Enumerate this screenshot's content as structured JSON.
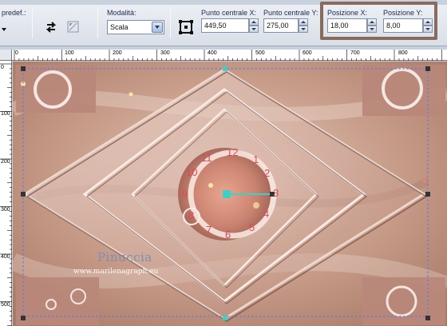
{
  "toolbar": {
    "preset_label": "predef.:",
    "mode_label": "Modalità:",
    "mode_value": "Scala",
    "center_x_label": "Punto centrale X:",
    "center_x_value": "449,50",
    "center_y_label": "Punto centrale Y:",
    "center_y_value": "275,00",
    "position_x_label": "Posizione X:",
    "position_x_value": "18,00",
    "position_y_label": "Posizione Y:",
    "position_y_value": "8,00",
    "highlight_color": "#8a6a5a"
  },
  "ruler": {
    "h_labels": [
      "0",
      "100",
      "200",
      "300",
      "400",
      "500",
      "600",
      "700",
      "800"
    ],
    "v_labels": [
      "0",
      "100",
      "200",
      "300",
      "400",
      "500"
    ]
  },
  "canvas": {
    "watermark_name": "Pinuccia",
    "watermark_url": "www.marilenagraph.eu",
    "clock_numbers": [
      "12",
      "1",
      "2",
      "3",
      "4",
      "5",
      "6",
      "7",
      "8",
      "9",
      "10",
      "11"
    ],
    "colors": {
      "background": "#c79c89",
      "light": "#efd9cf",
      "dark": "#8c5f52",
      "selection": "#6b6be0",
      "handle": "#3fcfc6"
    }
  },
  "icons": {
    "rotate": "rotate-icon",
    "flip": "flip-icon",
    "center": "center-point-icon"
  }
}
